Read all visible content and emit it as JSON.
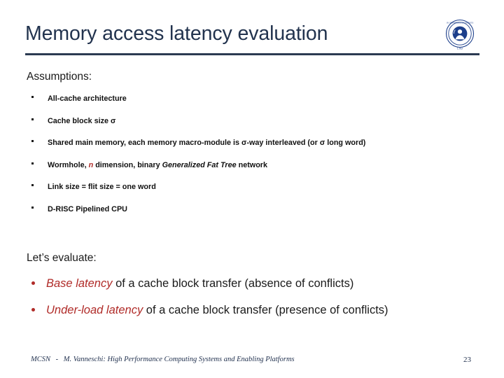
{
  "slide": {
    "title": "Memory access latency evaluation",
    "logo_name": "university-seal-logo",
    "accent_rule_color": "#2b3a52",
    "title_color": "#22334e",
    "accent_red": "#b02b28"
  },
  "assumptions": {
    "heading": "Assumptions:",
    "items": [
      {
        "parts": [
          {
            "t": "All-cache architecture",
            "s": "plain"
          }
        ]
      },
      {
        "parts": [
          {
            "t": "Cache block size ",
            "s": "plain"
          },
          {
            "t": "σ",
            "s": "sigma"
          }
        ]
      },
      {
        "parts": [
          {
            "t": "Shared main memory, each memory macro-module is ",
            "s": "plain"
          },
          {
            "t": "σ",
            "s": "sigma"
          },
          {
            "t": "-way interleaved (or ",
            "s": "plain"
          },
          {
            "t": "σ",
            "s": "sigma"
          },
          {
            "t": " long word)",
            "s": "plain"
          }
        ]
      },
      {
        "parts": [
          {
            "t": "Wormhole, ",
            "s": "plain"
          },
          {
            "t": "n",
            "s": "red-var"
          },
          {
            "t": " dimension, binary ",
            "s": "plain"
          },
          {
            "t": "Generalized Fat Tree",
            "s": "ital"
          },
          {
            "t": " network",
            "s": "plain"
          }
        ]
      },
      {
        "parts": [
          {
            "t": "Link size = flit size = one word",
            "s": "plain"
          }
        ]
      },
      {
        "parts": [
          {
            "t": "D-RISC Pipelined CPU",
            "s": "plain"
          }
        ]
      }
    ]
  },
  "evaluate": {
    "heading": "Let’s evaluate:",
    "items": [
      {
        "parts": [
          {
            "t": "Base latency",
            "s": "red-ital"
          },
          {
            "t": " of a cache block transfer (absence of conflicts)",
            "s": "plain"
          }
        ]
      },
      {
        "parts": [
          {
            "t": "Under-load latency",
            "s": "red-ital"
          },
          {
            "t": " of a cache block transfer (presence of conflicts)",
            "s": "plain"
          }
        ]
      }
    ]
  },
  "footer": {
    "course": "MCSN",
    "separator": "-",
    "citation": "M. Vanneschi: High Performance Computing Systems and Enabling Platforms",
    "page_number": "23"
  }
}
